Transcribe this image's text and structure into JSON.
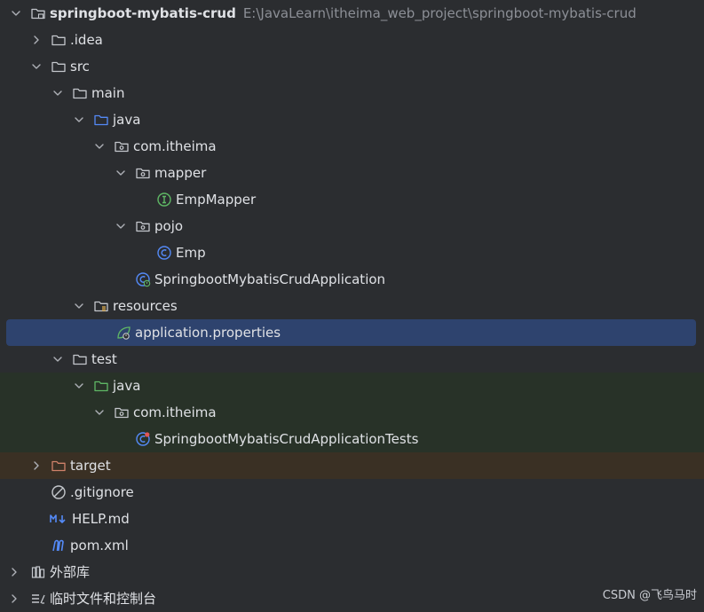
{
  "tree": {
    "root": {
      "label": "springboot-mybatis-crud",
      "path": "E:\\JavaLearn\\itheima_web_project\\springboot-mybatis-crud"
    },
    "idea": {
      "label": ".idea"
    },
    "src": {
      "label": "src"
    },
    "main": {
      "label": "main"
    },
    "java": {
      "label": "java"
    },
    "package": {
      "label": "com.itheima"
    },
    "mapper": {
      "label": "mapper"
    },
    "emp_mapper": {
      "label": "EmpMapper"
    },
    "pojo": {
      "label": "pojo"
    },
    "emp": {
      "label": "Emp"
    },
    "app": {
      "label": "SpringbootMybatisCrudApplication"
    },
    "resources": {
      "label": "resources"
    },
    "app_props": {
      "label": "application.properties"
    },
    "test": {
      "label": "test"
    },
    "test_java": {
      "label": "java"
    },
    "test_package": {
      "label": "com.itheima"
    },
    "app_tests": {
      "label": "SpringbootMybatisCrudApplicationTests"
    },
    "target": {
      "label": "target"
    },
    "gitignore": {
      "label": ".gitignore"
    },
    "help_md": {
      "label": "HELP.md"
    },
    "pom": {
      "label": "pom.xml"
    },
    "external_libs": {
      "label": "外部库"
    },
    "scratches": {
      "label": "临时文件和控制台"
    }
  },
  "watermark": "CSDN @飞鸟马时",
  "colors": {
    "background": "#2b2d30",
    "selection": "#2e436e",
    "test_zone": "#283228",
    "excluded_zone": "#3a3024",
    "java_folder": "#548af7",
    "test_folder": "#5fb865",
    "excluded_folder": "#d0826a"
  },
  "icons": {
    "chevron_expanded": "chevron-down-icon",
    "chevron_collapsed": "chevron-right-icon",
    "folder": "folder-icon",
    "package": "package-icon",
    "interface": "interface-icon",
    "class": "class-icon",
    "spring_boot_app": "spring-boot-class-icon",
    "properties": "spring-properties-icon",
    "ignore": "ignore-file-icon",
    "markdown": "markdown-icon",
    "maven": "maven-icon",
    "library": "library-icon",
    "scratch": "scratches-icon"
  }
}
